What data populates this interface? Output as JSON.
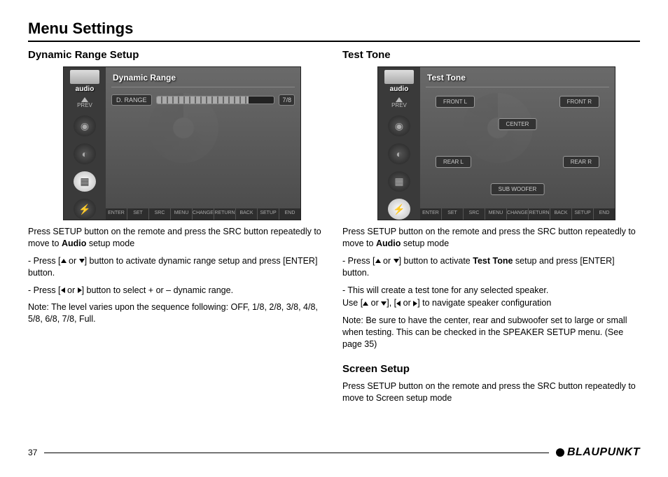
{
  "page": {
    "title": "Menu Settings",
    "number": "37",
    "brand": "BLAUPUNKT"
  },
  "left": {
    "heading": "Dynamic Range Setup",
    "osd": {
      "sidebar_label": "audio",
      "prev_label": "PREV",
      "title": "Dynamic Range",
      "drange_label": "D. RANGE",
      "drange_value": "7/8",
      "bottom": [
        "ENTER",
        "SET",
        "SRC",
        "MENU",
        "CHANGE",
        "RETURN",
        "BACK",
        "SETUP",
        "END"
      ]
    },
    "para1a": "Press SETUP button on the remote and press the SRC button repeatedly to move to ",
    "para1b": "Audio",
    "para1c": " setup mode",
    "bullet1a": "- Press [",
    "bullet1b": " or ",
    "bullet1c": "] button to activate dynamic range setup and press [ENTER] button.",
    "bullet2a": "- Press [",
    "bullet2b": " or ",
    "bullet2c": "] button to select + or – dynamic range.",
    "note": "Note: The level varies upon the sequence following: OFF, 1/8, 2/8, 3/8, 4/8, 5/8, 6/8, 7/8, Full."
  },
  "right": {
    "heading1": "Test Tone",
    "osd": {
      "sidebar_label": "audio",
      "prev_label": "PREV",
      "title": "Test Tone",
      "speakers": {
        "fl": "FRONT L",
        "fr": "FRONT R",
        "c": "CENTER",
        "rl": "REAR L",
        "rr": "REAR R",
        "sw": "SUB WOOFER"
      },
      "bottom": [
        "ENTER",
        "SET",
        "SRC",
        "MENU",
        "CHANGE",
        "RETURN",
        "BACK",
        "SETUP",
        "END"
      ]
    },
    "para1a": "Press SETUP button on the remote and press the SRC button repeatedly to move to ",
    "para1b": "Audio",
    "para1c": " setup mode",
    "bullet1a": "- Press [",
    "bullet1b": " or ",
    "bullet1c": "] button to activate ",
    "bullet1d": "Test Tone",
    "bullet1e": " setup and press [ENTER] button.",
    "bullet2": "- This will create a test tone for any selected speaker.",
    "bullet3a": "  Use [",
    "bullet3b": " or ",
    "bullet3c": "], [",
    "bullet3d": " or ",
    "bullet3e": "] to navigate speaker configuration",
    "note": "Note: Be sure to have the center, rear and subwoofer set to large or small when testing.  This can be checked in the SPEAKER SETUP menu. (See page 35)",
    "heading2": "Screen Setup",
    "para2": "Press SETUP button on the remote and press the SRC button repeatedly to move to Screen setup mode"
  }
}
